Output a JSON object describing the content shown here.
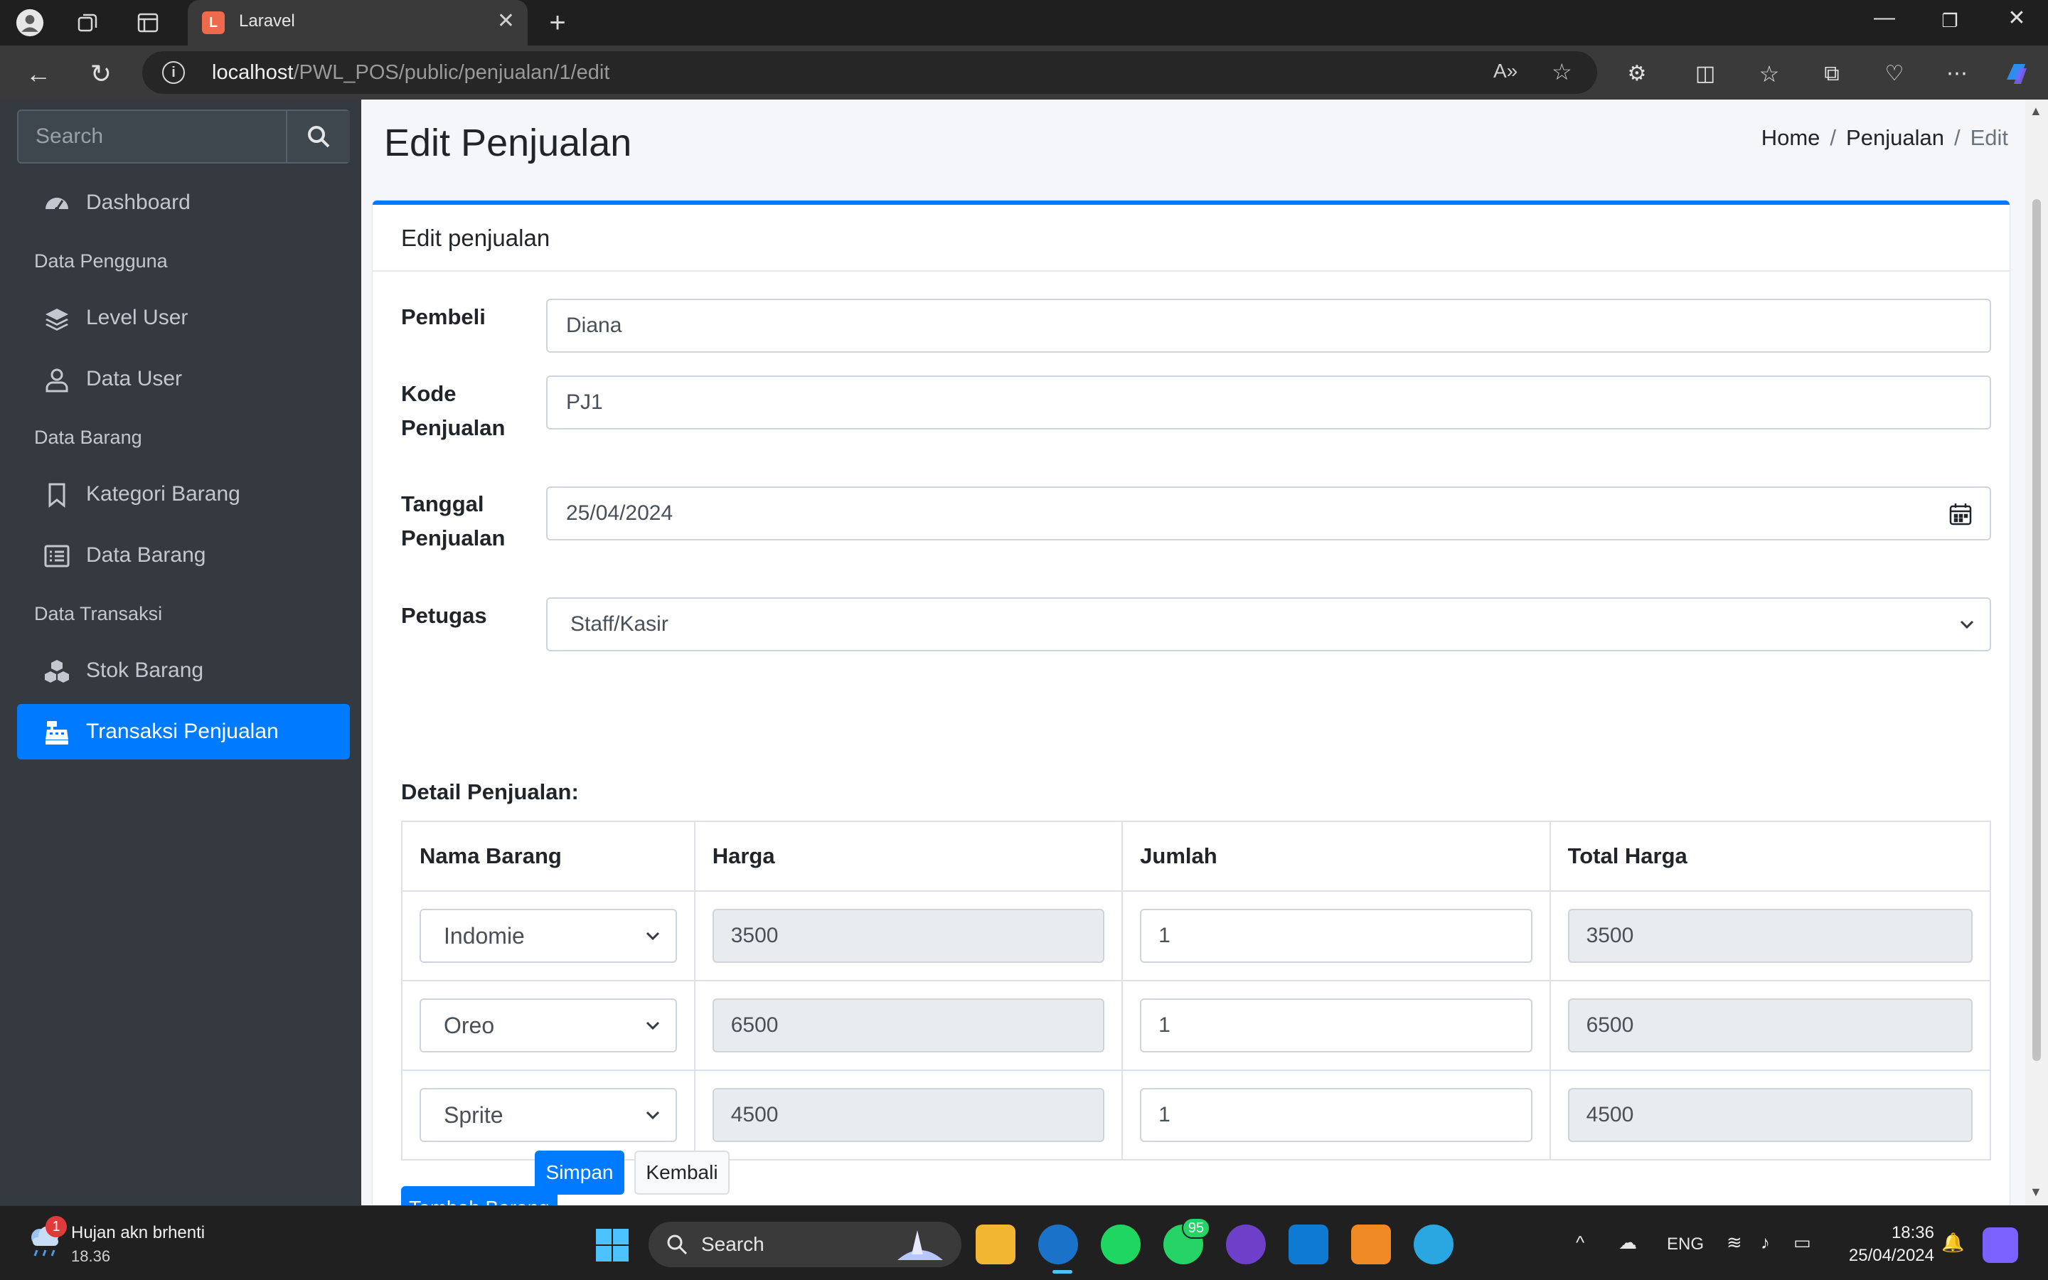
{
  "browser": {
    "tab_title": "Laravel",
    "url_host": "localhost",
    "url_path": "/PWL_POS/public/penjualan/1/edit"
  },
  "sidebar": {
    "search_placeholder": "Search",
    "items": [
      {
        "label": "Dashboard",
        "icon": "tachometer-icon"
      },
      {
        "header": "Data Pengguna"
      },
      {
        "label": "Level User",
        "icon": "layers-icon"
      },
      {
        "label": "Data User",
        "icon": "user-icon"
      },
      {
        "header": "Data Barang"
      },
      {
        "label": "Kategori Barang",
        "icon": "bookmark-icon"
      },
      {
        "label": "Data Barang",
        "icon": "list-icon"
      },
      {
        "header": "Data Transaksi"
      },
      {
        "label": "Stok Barang",
        "icon": "cubes-icon"
      },
      {
        "label": "Transaksi Penjualan",
        "icon": "cash-register-icon",
        "active": true
      }
    ]
  },
  "page": {
    "title": "Edit Penjualan",
    "breadcrumb": [
      "Home",
      "Penjualan",
      "Edit"
    ]
  },
  "card": {
    "title": "Edit penjualan",
    "fields": {
      "pembeli_label": "Pembeli",
      "pembeli_value": "Diana",
      "kode_label_1": "Kode",
      "kode_label_2": "Penjualan",
      "kode_value": "PJ1",
      "tanggal_label_1": "Tanggal",
      "tanggal_label_2": "Penjualan",
      "tanggal_value": "25/04/2024",
      "petugas_label": "Petugas",
      "petugas_value": "Staff/Kasir"
    },
    "detail_label": "Detail Penjualan:",
    "table": {
      "headers": [
        "Nama Barang",
        "Harga",
        "Jumlah",
        "Total Harga"
      ],
      "rows": [
        {
          "nama": "Indomie",
          "harga": "3500",
          "jumlah": "1",
          "total": "3500"
        },
        {
          "nama": "Oreo",
          "harga": "6500",
          "jumlah": "1",
          "total": "6500"
        },
        {
          "nama": "Sprite",
          "harga": "4500",
          "jumlah": "1",
          "total": "4500"
        }
      ]
    },
    "add_button": "Tambah Barang",
    "save_button": "Simpan",
    "back_button": "Kembali"
  },
  "taskbar": {
    "weather_text": "Hujan akn brhenti",
    "weather_sub": "18.36",
    "weather_badge": "1",
    "search_label": "Search",
    "whatsapp_badge": "95",
    "language": "ENG",
    "time": "18:36",
    "date": "25/04/2024"
  },
  "colors": {
    "accent": "#007bff",
    "sidebar_bg": "#343a40",
    "content_bg": "#f4f6f9"
  }
}
